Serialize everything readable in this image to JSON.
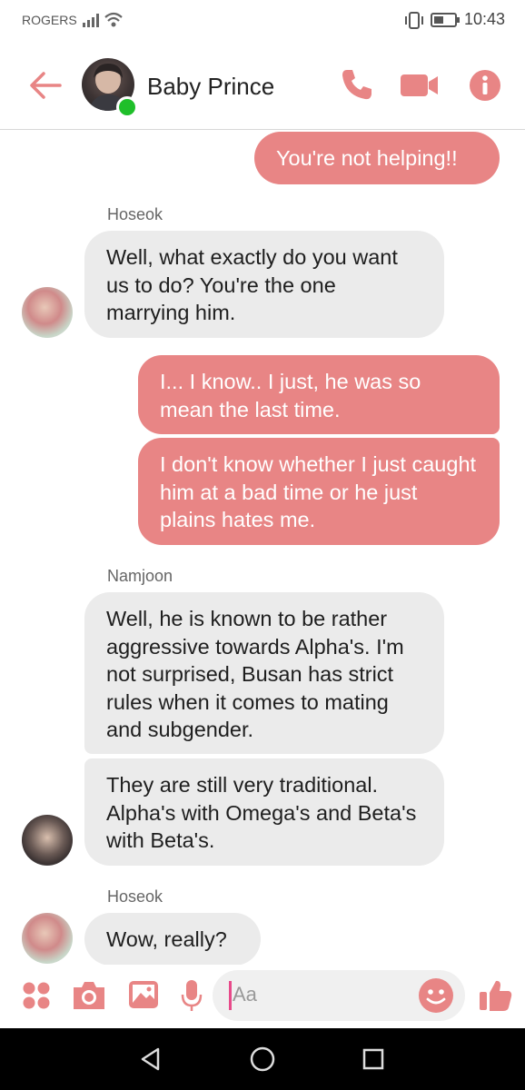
{
  "status_bar": {
    "carrier": "ROGERS",
    "time": "10:43",
    "icons": [
      "signal-icon",
      "wifi-icon",
      "vibrate-icon",
      "battery-icon"
    ]
  },
  "header": {
    "title": "Baby Prince",
    "accent_color": "#e88585",
    "icons": [
      "back-arrow-icon",
      "phone-icon",
      "video-icon",
      "info-icon"
    ]
  },
  "messages": [
    {
      "type": "outgoing",
      "text": "You're not helping!!"
    },
    {
      "type": "sender",
      "text": "Hoseok"
    },
    {
      "type": "incoming",
      "text": "Well, what exactly do you want us to do? You're the one marrying him."
    },
    {
      "type": "outgoing",
      "text": "I... I know.. I just, he was so mean the last time."
    },
    {
      "type": "outgoing",
      "text": "I don't know whether I just caught him at a bad time or he just plains hates me."
    },
    {
      "type": "sender",
      "text": "Namjoon"
    },
    {
      "type": "incoming",
      "text": "Well, he is known to be rather aggressive towards Alpha's. I'm not surprised, Busan has strict rules when it comes to mating and subgender."
    },
    {
      "type": "incoming",
      "text": "They are still very traditional. Alpha's with Omega's and Beta's with Beta's."
    },
    {
      "type": "sender",
      "text": "Hoseok"
    },
    {
      "type": "incoming",
      "text": "Wow, really?"
    }
  ],
  "composer": {
    "placeholder": "Aa",
    "icons": [
      "apps-grid-icon",
      "camera-icon",
      "image-icon",
      "microphone-icon",
      "emoji-icon",
      "thumbs-up-icon"
    ]
  },
  "navbar": {
    "icons": [
      "back-triangle-icon",
      "home-circle-icon",
      "recents-square-icon"
    ]
  }
}
